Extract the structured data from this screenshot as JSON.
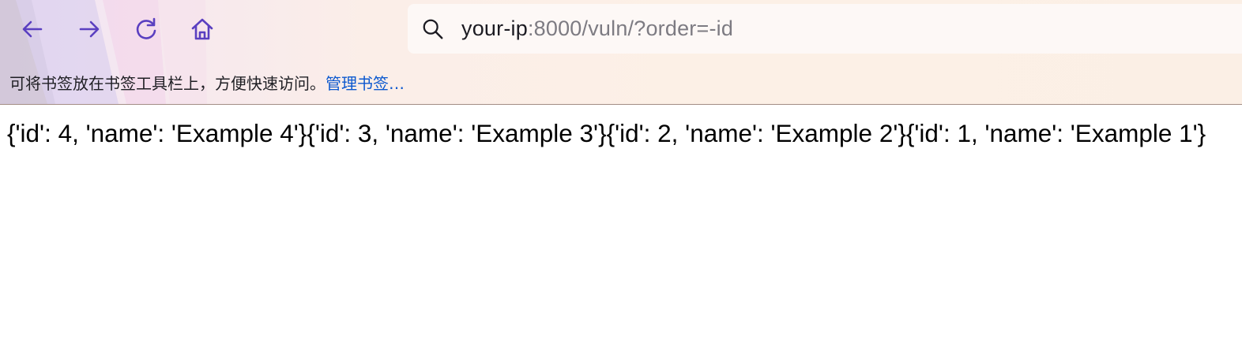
{
  "browser": {
    "accent_color": "#5a3fc0",
    "nav": {
      "back_icon": "arrow-left-icon",
      "forward_icon": "arrow-right-icon",
      "reload_icon": "reload-icon",
      "home_icon": "home-icon"
    },
    "urlbar": {
      "icon": "search-icon",
      "host": "your-ip",
      "rest": ":8000/vuln/?order=-id"
    },
    "bookmarks_bar": {
      "hint": "可将书签放在书签工具栏上，方便快速访问。",
      "manage_link": "管理书签…"
    }
  },
  "page": {
    "response_body": "{'id': 4, 'name': 'Example 4'}{'id': 3, 'name': 'Example 3'}{'id': 2, 'name': 'Example 2'}{'id': 1, 'name': 'Example 1'}"
  }
}
